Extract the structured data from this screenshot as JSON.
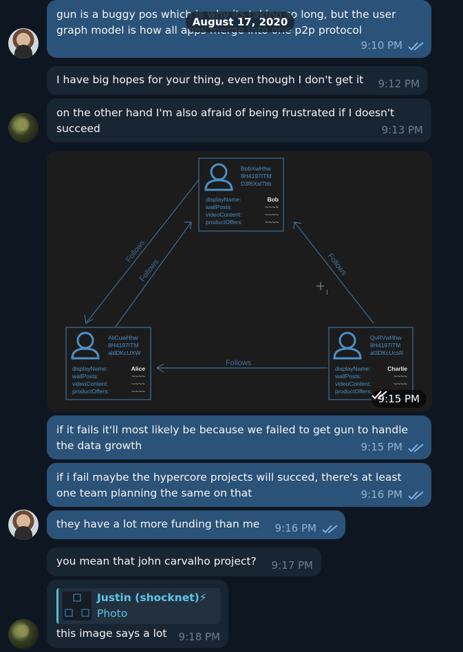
{
  "date_pill": "August 17, 2020",
  "messages": [
    {
      "text": "gun is a buggy pos which is why its taking so long, but the user graph model is how all apps merge into one p2p protocol",
      "time": "9:10 PM"
    },
    {
      "text": "I have big hopes for your thing, even though I don't get it",
      "time": "9:12 PM"
    },
    {
      "text": "on the other hand I'm also afraid of being frustrated if I doesn't succeed",
      "time": "9:13 PM"
    },
    {
      "text": "if it fails it'll most likely be because we failed to get gun to handle the data growth",
      "time": "9:15 PM"
    },
    {
      "text": "if i fail maybe the hypercore projects will succed, there's at least one team planning the same on that",
      "time": "9:16 PM"
    },
    {
      "text": "they have a lot more funding than me",
      "time": "9:16 PM"
    },
    {
      "text": "you mean that john carvalho project?",
      "time": "9:17 PM"
    },
    {
      "text": "this image says a lot",
      "time": "9:18 PM"
    }
  ],
  "photo": {
    "time": "9:15 PM",
    "follows_label": "Follows",
    "cursor_glyph": "I",
    "users": {
      "bob": {
        "id1": "BobXwHhw",
        "id2": "8H4197ITM",
        "id3": "D3f6Xst7bb",
        "name": "Bob"
      },
      "alice": {
        "id1": "AliCuwHhw",
        "id2": "8H4197ITM",
        "id3": "aldDKcUXW",
        "name": "Alice"
      },
      "charlie": {
        "id1": "QvRVwHhw",
        "id2": "8H4197ITM",
        "id3": "al3DKcUcsR",
        "name": "Charlie"
      }
    },
    "fields": {
      "display_name": "displayName:",
      "wall_posts": "wallPosts:",
      "video_content": "videoContent:",
      "product_offers": "productOffers:",
      "placeholder": "~~~~"
    }
  },
  "reply": {
    "name": "Justin (shocknet)⚡",
    "label": "Photo"
  },
  "colors": {
    "background": "#0e1621",
    "outgoing_bubble": "#2b5278",
    "incoming_bubble": "#182533",
    "read_ticks": "#7ab4e6",
    "diagram_blue": "#4a90c8",
    "reply_accent": "#4ec0d8"
  }
}
